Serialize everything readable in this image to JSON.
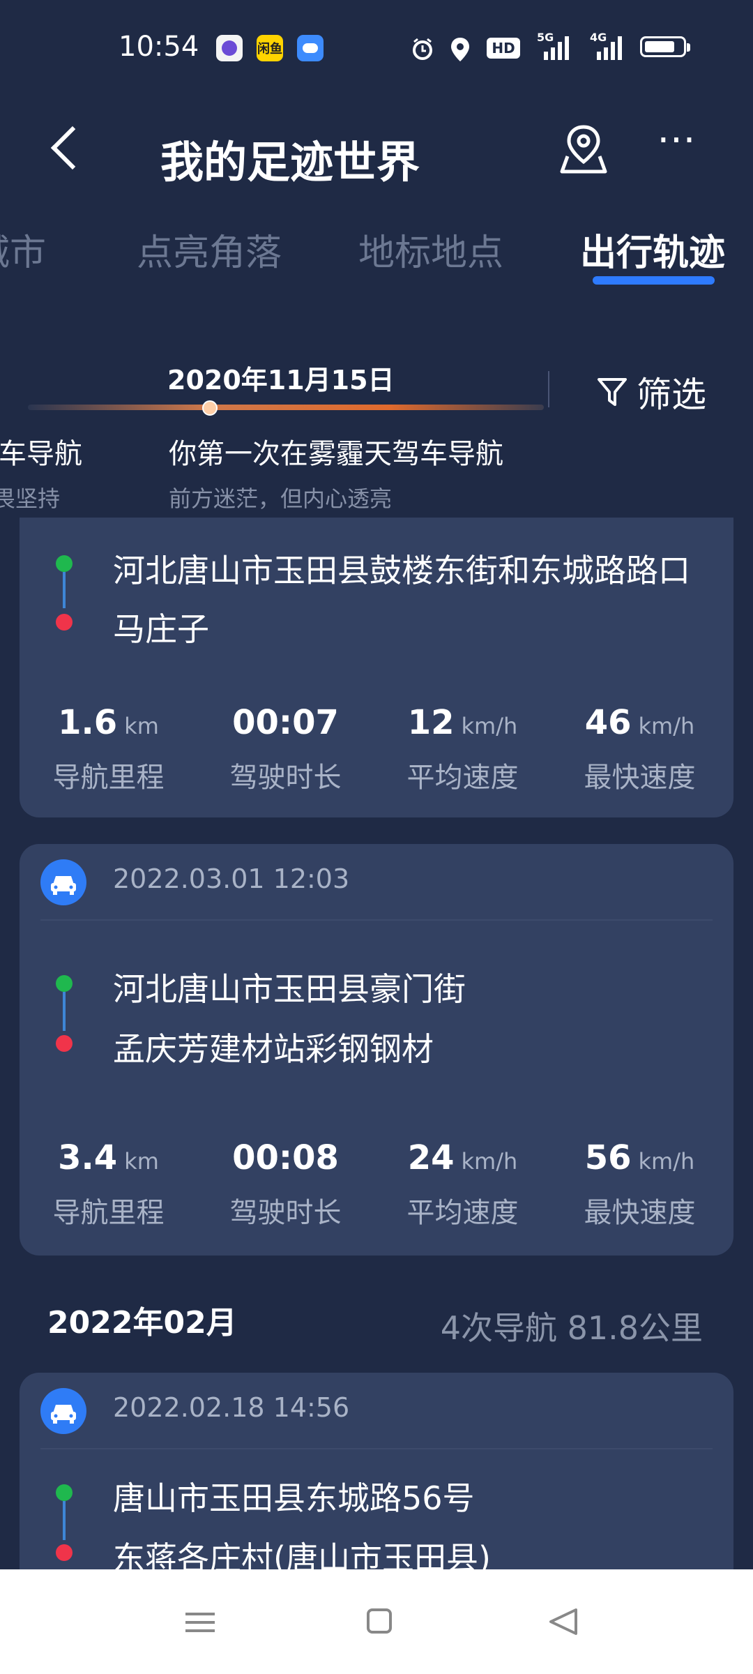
{
  "status_bar": {
    "time": "10:54",
    "apps": [
      {
        "name": "app-icon-purple",
        "color": "#f4f4f4"
      },
      {
        "name": "xianyu-app-icon",
        "color": "#ffd400",
        "label": "闲鱼"
      },
      {
        "name": "cloud-app-icon",
        "color": "#3d8bfd"
      }
    ],
    "icons": [
      "alarm-icon",
      "location-icon",
      "hd-icon",
      "5g-signal-icon",
      "4g-signal-icon",
      "battery-icon"
    ],
    "hd_label": "HD",
    "signal1": "5G",
    "signal2": "4G",
    "battery_level": 0.8
  },
  "header": {
    "title": "我的足迹世界",
    "back_icon": "back-arrow-icon",
    "location_icon": "map-pin-icon",
    "more_icon": "more-dots-icon",
    "more_glyph": "⋯"
  },
  "tabs": [
    {
      "label": "城市",
      "active": false
    },
    {
      "label": "点亮角落",
      "active": false
    },
    {
      "label": "地标地点",
      "active": false
    },
    {
      "label": "出行轨迹",
      "active": true
    }
  ],
  "timeline": {
    "date": "2020年11月15日",
    "filter_label": "筛选",
    "items": [
      {
        "title": "驾车导航",
        "subtitle": "无畏坚持"
      },
      {
        "title": "你第一次在雾霾天驾车导航",
        "subtitle": "前方迷茫，但内心透亮"
      }
    ]
  },
  "cards": [
    {
      "time": "",
      "start": "河北唐山市玉田县鼓楼东街和东城路路口",
      "end": "马庄子",
      "stats": [
        {
          "value": "1.6",
          "unit": "km",
          "label": "导航里程"
        },
        {
          "value": "00:07",
          "unit": "",
          "label": "驾驶时长"
        },
        {
          "value": "12",
          "unit": "km/h",
          "label": "平均速度"
        },
        {
          "value": "46",
          "unit": "km/h",
          "label": "最快速度"
        }
      ]
    },
    {
      "time": "2022.03.01 12:03",
      "start": "河北唐山市玉田县豪门街",
      "end": "孟庆芳建材站彩钢钢材",
      "stats": [
        {
          "value": "3.4",
          "unit": "km",
          "label": "导航里程"
        },
        {
          "value": "00:08",
          "unit": "",
          "label": "驾驶时长"
        },
        {
          "value": "24",
          "unit": "km/h",
          "label": "平均速度"
        },
        {
          "value": "56",
          "unit": "km/h",
          "label": "最快速度"
        }
      ]
    },
    {
      "time": "2022.02.18 14:56",
      "start": "唐山市玉田县东城路56号",
      "end": "东蒋各庄村(唐山市玉田县)"
    }
  ],
  "month_group": {
    "month": "2022年02月",
    "summary": "4次导航  81.8公里"
  },
  "nav_bar": {
    "icons": [
      "menu-icon",
      "home-square-icon",
      "back-triangle-icon"
    ]
  }
}
